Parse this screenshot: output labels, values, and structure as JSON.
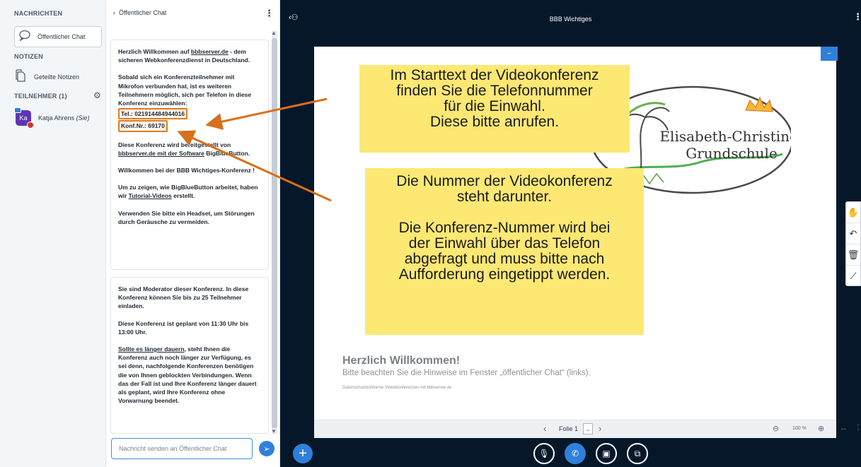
{
  "userlist": {
    "messages_title": "NACHRICHTEN",
    "public_chat_label": "Öffentlicher Chat",
    "notes_title": "NOTIZEN",
    "shared_notes_label": "Geteilte Notizen",
    "users_title": "TEILNEHMER (1)",
    "user": {
      "initials": "Ka",
      "name": "Katja Ahrens",
      "self_tag": "(Sie)"
    }
  },
  "chat": {
    "header": "Öffentlicher Chat",
    "message1": {
      "welcome_pre": "Herzlich Willkommen auf ",
      "welcome_link": "bbbserver.de",
      "welcome_post": " - dem sicheren Webkonferenzdienst in Deutschland.",
      "dialin_text": "Sobald sich ein Konferenzteilnehmer mit Mikrofon verbunden hat, ist es weiteren Teilnehmern möglich, sich per Telefon in diese Konferenz einzuwählen:",
      "tel": "Tel.: 021914484944016",
      "conf": "Konf.Nr.: 69170",
      "provided_pre": "Diese Konferenz wird bereitgestellt von ",
      "provided_link": "bbbserver.de mit der Software",
      "provided_post": " BigBlueButton.",
      "welcome2": "Willkommen bei der BBB Wichtiges-Konferenz !",
      "tutorial_pre": "Um zu zeigen, wie BigBlueButton arbeitet, haben wir ",
      "tutorial_link": "Tutorial-Videos",
      "tutorial_post": " erstellt.",
      "headset": "Verwenden Sie bitte ein Headset, um Störungen durch Geräusche zu vermeiden."
    },
    "message2": {
      "moderator": "Sie sind Moderator dieser Konferenz. In diese Konferenz können Sie bis zu 25 Teilnehmer einladen.",
      "schedule": "Diese Konferenz ist geplant von 11:30 Uhr bis 13:00 Uhr.",
      "longer_link": "Sollte es länger dauern",
      "longer_text": ", steht Ihnen die Konferenz auch noch länger zur Verfügung, es sei denn, nachfolgende Konferenzen benötigen die von Ihnen geblockten Verbindungen. Wenn das der Fall ist und Ihre Konferenz länger dauert als geplant, wird Ihre Konferenz ohne Vorwarnung beendet."
    },
    "input_placeholder": "Nachricht senden an Öffentlicher Chat"
  },
  "stage": {
    "title": "BBB Wichtiges",
    "note1": [
      "Im Starttext der Videokonferenz",
      "finden Sie die Telefonnummer",
      "für die Einwahl.",
      "Diese bitte anrufen."
    ],
    "note2": [
      "Die Nummer der Videokonferenz",
      "steht darunter.",
      "",
      "Die Konferenz-Nummer wird bei",
      "der Einwahl über das Telefon",
      "abgefragt und muss bitte nach",
      "Aufforderung eingetippt werden."
    ],
    "logo_line1": "Elisabeth-Christinen-",
    "logo_line2": "Grundschule",
    "welcome_title": "Herzlich Willkommen!",
    "welcome_sub": "Bitte beachten Sie die Hinweise im Fenster „öffentlicher Chat“ (links).",
    "welcome_foot": "Datenschutzkonforme Videokonferenzen mit bbbserver.de",
    "slide_label": "Folie 1",
    "zoom": "100 %"
  },
  "colors": {
    "accent": "#2f80d9",
    "note": "#fde874",
    "arrow": "#d8701c",
    "stage_bg": "#06172a"
  }
}
